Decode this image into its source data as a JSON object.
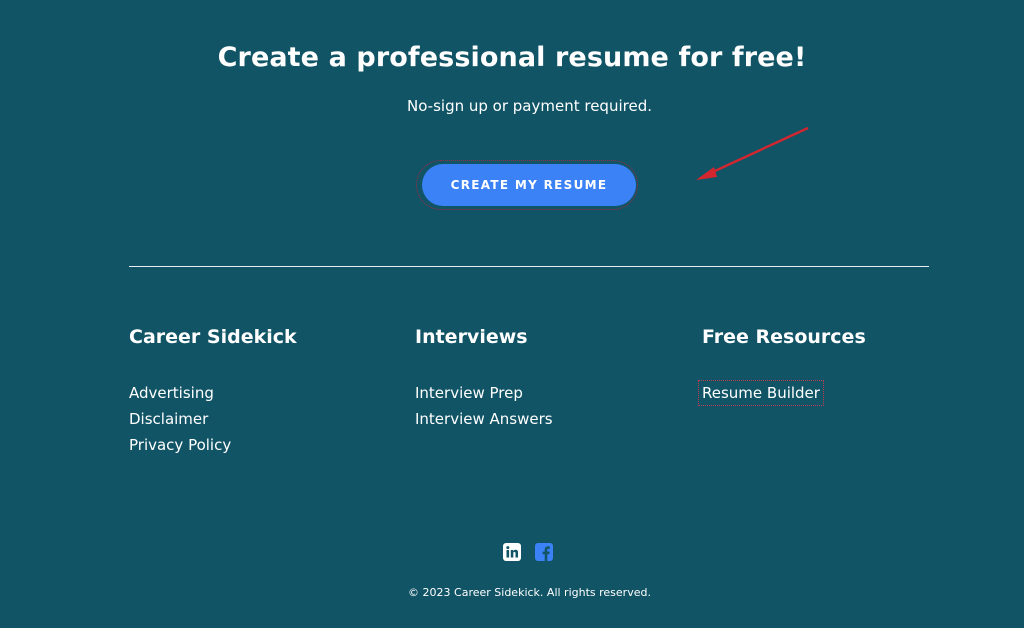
{
  "hero": {
    "title": "Create a professional resume for free!",
    "subtitle": "No-sign up or payment required.",
    "cta_label": "CREATE MY RESUME"
  },
  "footer": {
    "columns": [
      {
        "heading": "Career Sidekick",
        "links": [
          "Advertising",
          "Disclaimer",
          "Privacy Policy"
        ]
      },
      {
        "heading": "Interviews",
        "links": [
          "Interview Prep",
          "Interview Answers"
        ]
      },
      {
        "heading": "Free Resources",
        "links": [
          "Resume Builder"
        ]
      }
    ],
    "social": [
      {
        "icon": "linkedin-icon"
      },
      {
        "icon": "facebook-icon"
      }
    ],
    "copyright": "© 2023 Career Sidekick. All rights reserved."
  },
  "colors": {
    "background": "#115466",
    "accent": "#3b82f6",
    "annotation": "#d4262f"
  }
}
